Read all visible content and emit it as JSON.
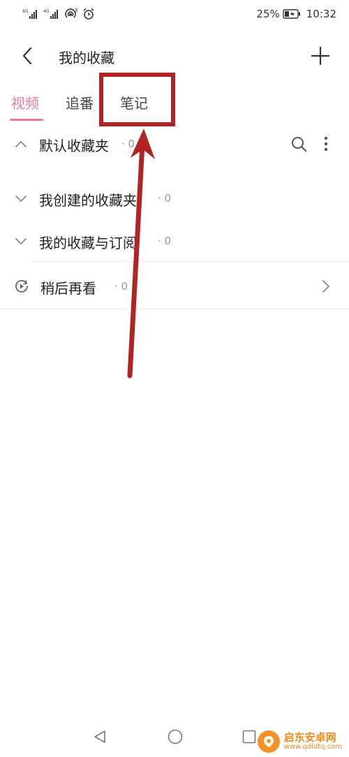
{
  "status_bar": {
    "battery": "25%",
    "time": "10:32"
  },
  "header": {
    "title": "我的收藏"
  },
  "tabs": [
    {
      "label": "视频",
      "active": true
    },
    {
      "label": "追番",
      "active": false
    },
    {
      "label": "笔记",
      "active": false
    }
  ],
  "folders": [
    {
      "title": "默认收藏夹",
      "count": "· 0",
      "expanded": true
    },
    {
      "title": "我创建的收藏夹",
      "count": "· 0",
      "expanded": false
    },
    {
      "title": "我的收藏与订阅",
      "count": "· 0",
      "expanded": false
    }
  ],
  "watch_later": {
    "title": "稍后再看",
    "count": "· 0"
  },
  "watermark": {
    "name": "启东安卓网",
    "url": "www.qdldtq.com"
  },
  "colors": {
    "accent": "#e97ba0",
    "annotation": "#b22424"
  },
  "icons": [
    "signal-icon",
    "hotspot-icon",
    "alarm-icon",
    "battery-icon",
    "back-icon",
    "add-icon",
    "chevron-up-icon",
    "chevron-down-icon",
    "search-icon",
    "more-vertical-icon",
    "watch-later-icon",
    "chevron-right-icon",
    "nav-back-icon",
    "nav-home-icon",
    "nav-recent-icon"
  ]
}
